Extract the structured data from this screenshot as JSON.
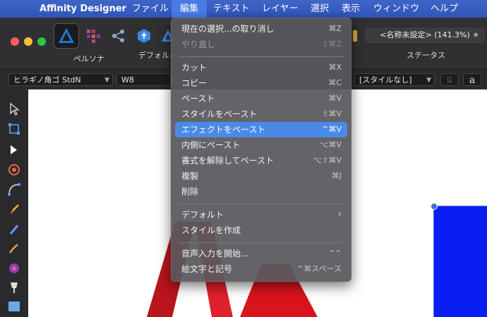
{
  "menubar": {
    "app_name": "Affinity Designer",
    "items": [
      "ファイル",
      "編集",
      "テキスト",
      "レイヤー",
      "選択",
      "表示",
      "ウィンドウ",
      "ヘルプ"
    ]
  },
  "toolbar": {
    "persona_label": "ペルソナ",
    "default_label": "デフォルト",
    "document_title": "<名称未設定> (141.3%)",
    "status_label": "ステータス"
  },
  "contextbar": {
    "font_family": "ヒラギノ角ゴ StdN",
    "font_weight": "W8",
    "style": "[スタイルなし]",
    "text_icon": "a"
  },
  "edit_menu": {
    "items": [
      {
        "label": "現在の選択...の取り消し",
        "shortcut": "⌘Z",
        "state": "normal"
      },
      {
        "label": "やり直し",
        "shortcut": "⇧⌘Z",
        "state": "disabled"
      },
      {
        "label": "カット",
        "shortcut": "⌘X",
        "state": "normal"
      },
      {
        "label": "コピー",
        "shortcut": "⌘C",
        "state": "normal"
      },
      {
        "label": "ペースト",
        "shortcut": "⌘V",
        "state": "normal"
      },
      {
        "label": "スタイルをペースト",
        "shortcut": "⇧⌘V",
        "state": "normal"
      },
      {
        "label": "エフェクトをペースト",
        "shortcut": "^⌘V",
        "state": "highlighted"
      },
      {
        "label": "内側にペースト",
        "shortcut": "⌥⌘V",
        "state": "normal"
      },
      {
        "label": "書式を解除してペースト",
        "shortcut": "⌥⇧⌘V",
        "state": "normal"
      },
      {
        "label": "複製",
        "shortcut": "⌘J",
        "state": "normal"
      },
      {
        "label": "削除",
        "shortcut": "",
        "state": "normal"
      },
      {
        "label": "デフォルト",
        "shortcut": "",
        "state": "submenu"
      },
      {
        "label": "スタイルを作成",
        "shortcut": "",
        "state": "normal"
      },
      {
        "label": "音声入力を開始...",
        "shortcut": "^^",
        "state": "normal"
      },
      {
        "label": "絵文字と記号",
        "shortcut": "^⌘スペース",
        "state": "normal"
      }
    ]
  },
  "colors": {
    "menubar": "#3a5fc4",
    "highlight": "#4a8ae6",
    "canvas_shape": "#0a1df5",
    "logo_red": "#d8141c"
  }
}
